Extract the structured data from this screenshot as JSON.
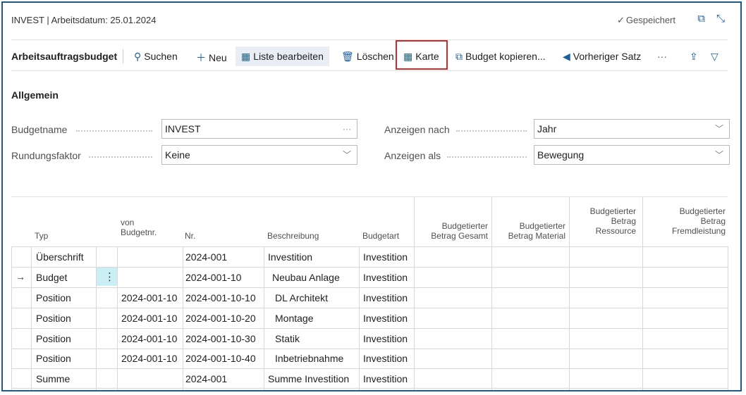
{
  "header": {
    "title": "INVEST | Arbeitsdatum: 25.01.2024",
    "saved_label": "Gespeichert",
    "saved_check": "✓",
    "open_icon": "⧉",
    "collapse_icon": "⤡"
  },
  "toolbar": {
    "page_name": "Arbeitsauftragsbudget",
    "search_label": "Suchen",
    "new_label": "Neu",
    "edit_list_label": "Liste bearbeiten",
    "delete_label": "Löschen",
    "card_label": "Karte",
    "copy_budget_label": "Budget kopieren...",
    "previous_label": "Vorheriger Satz",
    "more_label": "···",
    "share_icon": "⇪",
    "filter_icon": "▽"
  },
  "general": {
    "section_title": "Allgemein",
    "budget_name_label": "Budgetname",
    "budget_name_value": "INVEST",
    "budget_name_more": "···",
    "rounding_label": "Rundungsfaktor",
    "rounding_value": "Keine",
    "show_by_label": "Anzeigen nach",
    "show_by_value": "Jahr",
    "show_as_label": "Anzeigen als",
    "show_as_value": "Bewegung"
  },
  "table": {
    "headers": {
      "typ": "Typ",
      "von_line1": "von",
      "von_line2": "Budgetnr.",
      "nr": "Nr.",
      "beschreibung": "Beschreibung",
      "budgetart": "Budgetart",
      "gesamt_line1": "Budgetierter",
      "gesamt_line2": "Betrag Gesamt",
      "material_line1": "Budgetierter",
      "material_line2": "Betrag Material",
      "ressource_line1": "Budgetierter",
      "ressource_line2": "Betrag",
      "ressource_line3": "Ressource",
      "fremd_line1": "Budgetierter",
      "fremd_line2": "Betrag",
      "fremd_line3": "Fremdleistung"
    },
    "rows": [
      {
        "typ": "Überschrift",
        "von": "",
        "nr": "2024-001",
        "beschreibung": "Investition",
        "budgetart": "Investition"
      },
      {
        "typ": "Budget",
        "von": "",
        "nr": "2024-001-10",
        "beschreibung": "Neubau Anlage",
        "budgetart": "Investition"
      },
      {
        "typ": "Position",
        "von": "2024-001-10",
        "nr": "2024-001-10-10",
        "beschreibung": "DL Architekt",
        "budgetart": "Investition"
      },
      {
        "typ": "Position",
        "von": "2024-001-10",
        "nr": "2024-001-10-20",
        "beschreibung": "Montage",
        "budgetart": "Investition"
      },
      {
        "typ": "Position",
        "von": "2024-001-10",
        "nr": "2024-001-10-30",
        "beschreibung": "Statik",
        "budgetart": "Investition"
      },
      {
        "typ": "Position",
        "von": "2024-001-10",
        "nr": "2024-001-10-40",
        "beschreibung": "Inbetriebnahme",
        "budgetart": "Investition"
      },
      {
        "typ": "Summe",
        "von": "",
        "nr": "2024-001",
        "beschreibung": "Summe Investition",
        "budgetart": "Investition"
      }
    ],
    "current_row_arrow": "→",
    "row_menu": "⋮"
  }
}
